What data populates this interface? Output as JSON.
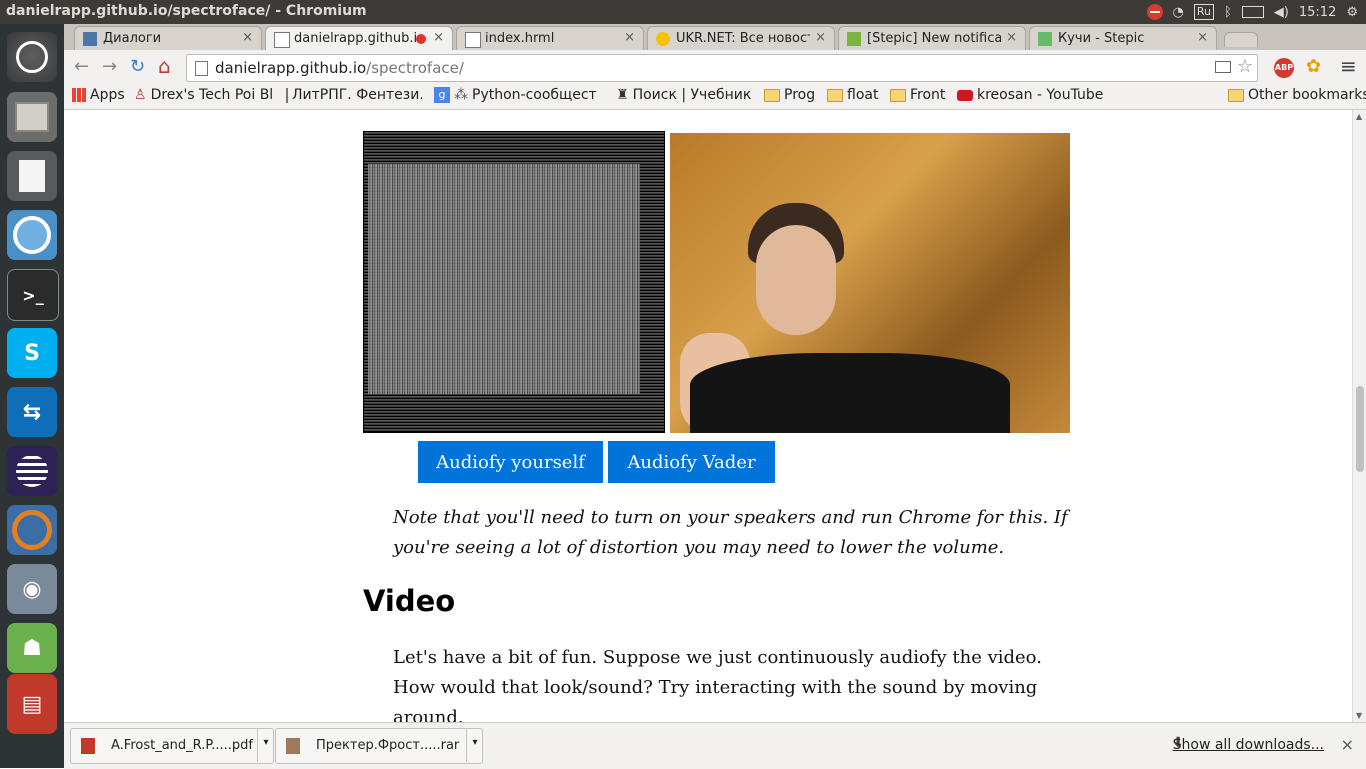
{
  "window": {
    "title": "danielrapp.github.io/spectroface/ - Chromium"
  },
  "tray": {
    "keyboard": "Ru",
    "time": "15:12"
  },
  "tabs": [
    {
      "label": "Диалоги",
      "close": "×"
    },
    {
      "label": "danielrapp.github.io",
      "close": "×"
    },
    {
      "label": "index.hrml",
      "close": "×"
    },
    {
      "label": "UKR.NET: Все новости",
      "close": "×"
    },
    {
      "label": "[Stepic] New notificat",
      "close": "×"
    },
    {
      "label": "Кучи - Stepic",
      "close": "×"
    }
  ],
  "toolbar": {
    "back": "←",
    "forward": "→",
    "reload": "↻",
    "home": "⌂",
    "url_host": "danielrapp.github.io",
    "url_path": "/spectroface/",
    "abp": "ABP",
    "menu": "≡"
  },
  "bookmarks": [
    {
      "label": "Apps",
      "icon": "apps-icon"
    },
    {
      "label": "Drex's Tech Poi Blo",
      "icon": "drex-icon"
    },
    {
      "label": "ЛитРПГ. Фентези.",
      "icon": "page-icon"
    },
    {
      "label": "Python-сообщест",
      "icon": "python-icon"
    },
    {
      "label": "Поиск | Учебник J",
      "icon": "search-bm-icon"
    },
    {
      "label": "Prog",
      "icon": "folder-icon"
    },
    {
      "label": "float",
      "icon": "folder-icon"
    },
    {
      "label": "Front",
      "icon": "folder-icon"
    },
    {
      "label": "kreosan - YouTube",
      "icon": "youtube-icon"
    }
  ],
  "other_bookmarks": "Other bookmarks",
  "main": {
    "button_yourself": "Audiofy yourself",
    "button_vader": "Audiofy Vader",
    "note": "Note that you'll need to turn on your speakers and run Chrome for this. If you're seeing a lot of distortion you may need to lower the volume.",
    "heading": "Video",
    "paragraph": "Let's have a bit of fun. Suppose we just continuously audiofy the video. How would that look/sound? Try interacting with the sound by moving around."
  },
  "downloads": {
    "items": [
      {
        "name": "A.Frost_and_R.P.....pdf",
        "icon": "pdf-icon"
      },
      {
        "name": "Пректер.Фрост.....rar",
        "icon": "archive-icon"
      }
    ],
    "show_all": "Show all downloads...",
    "close": "×"
  },
  "colors": {
    "button_blue": "#0074d9",
    "launcher": "#2e3436",
    "topbar": "#3c3b37"
  }
}
